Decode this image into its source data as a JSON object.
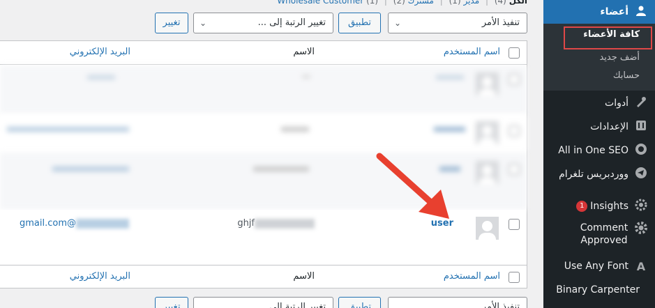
{
  "sidebar": {
    "users_label": "أعضاء",
    "submenu": {
      "all_users": "كافة الأعضاء",
      "add_new": "أضف جديد",
      "profile": "حسابك"
    },
    "items": [
      {
        "label": "أدوات",
        "icon": "wrench-icon"
      },
      {
        "label": "الإعدادات",
        "icon": "settings-icon"
      },
      {
        "label": "All in One SEO",
        "icon": "aioseo-gear-icon"
      },
      {
        "label": "ووردبريس تلغرام",
        "icon": "telegram-icon"
      },
      {
        "label": "Insights",
        "icon": "insights-icon",
        "badge": "1"
      },
      {
        "label": "Comment Approved",
        "icon": "gear-icon"
      },
      {
        "label": "Use Any Font",
        "icon": "font-a-icon",
        "icon_glyph": "A"
      },
      {
        "label": "Binary Carpenter",
        "icon": ""
      }
    ]
  },
  "views": {
    "all": "الكل",
    "all_count": "(4)",
    "admin": "مدير",
    "admin_count": "(1)",
    "subscriber": "مشترك",
    "subscriber_count": "(2)",
    "wholesale": "Wholesale Customer",
    "wholesale_count": "(1)",
    "separator": "|"
  },
  "tablenav": {
    "bulk_action": "تنفيذ الأمر",
    "apply": "تطبيق",
    "change_role": "تغيير الرتبة إلى ...",
    "change": "تغيير"
  },
  "columns": {
    "username": "اسم المستخدم",
    "name": "الاسم",
    "email": "البريد الإلكتروني"
  },
  "user_row": {
    "username": "user",
    "name_suffix": "ghjf",
    "email_suffix": "@gmail.com"
  },
  "colors": {
    "accent": "#2271b1",
    "sidebar_bg": "#1d2327",
    "submenu_bg": "#2c3338",
    "highlight": "#e04848",
    "arrow": "#e8402f"
  }
}
